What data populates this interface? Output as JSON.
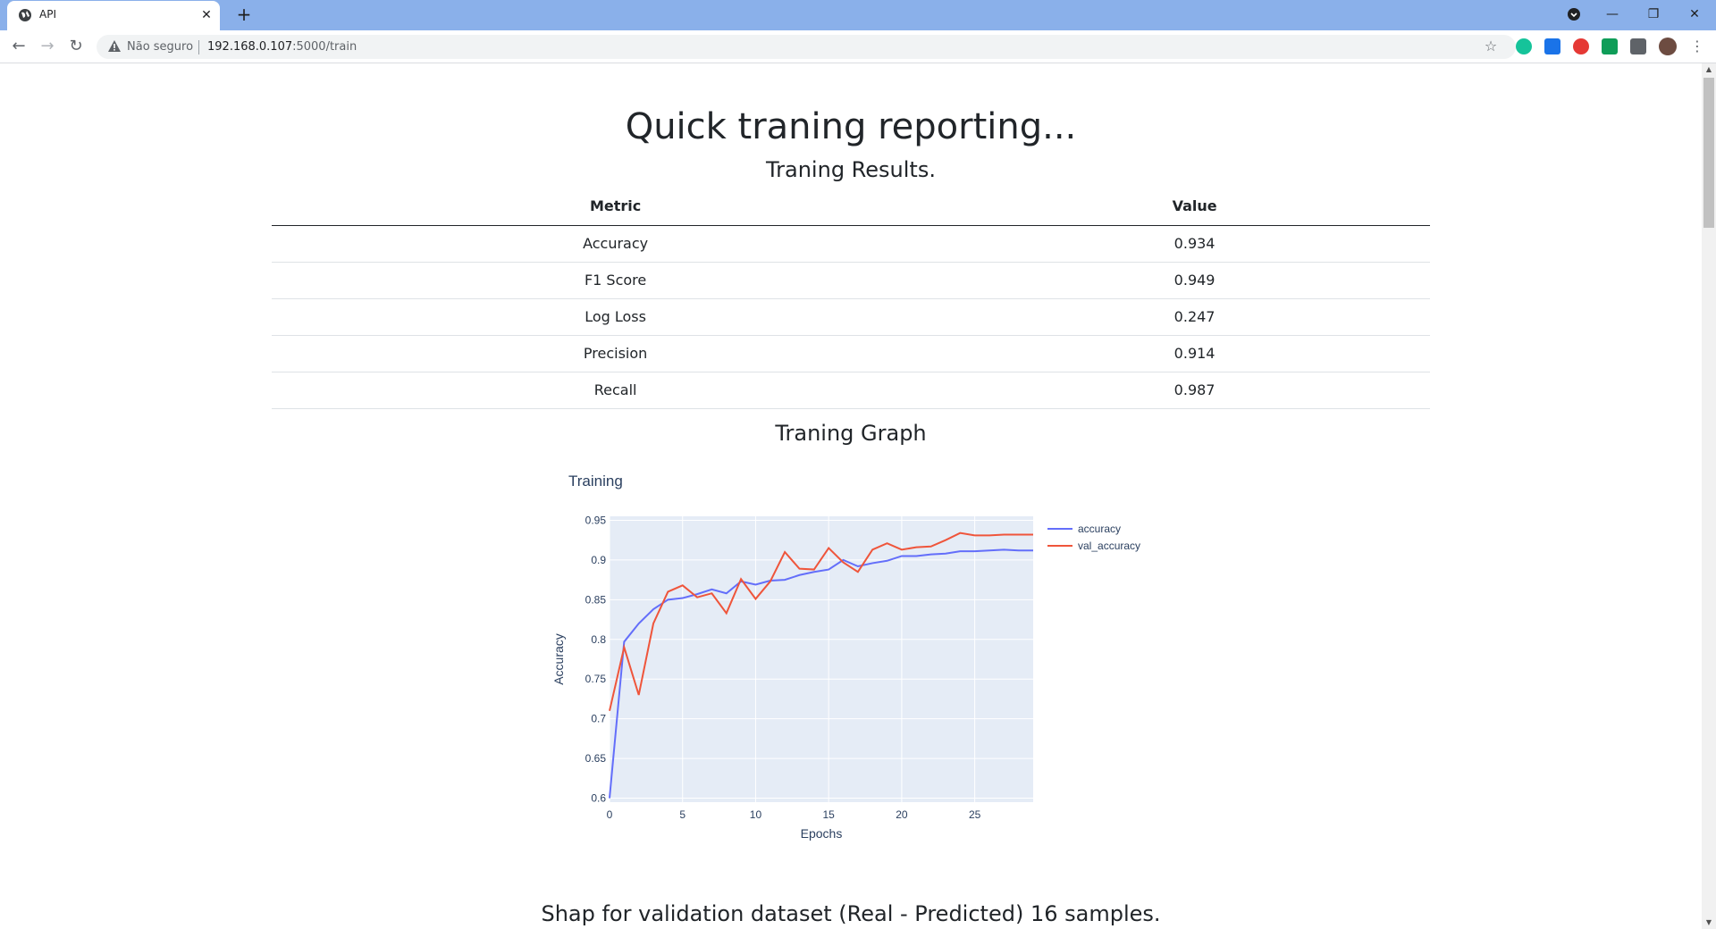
{
  "browser": {
    "tab_title": "API",
    "not_secure_label": "Não seguro",
    "url_host": "192.168.0.107",
    "url_path": ":5000/train"
  },
  "page": {
    "title": "Quick traning reporting...",
    "results_heading": "Traning Results.",
    "graph_heading": "Traning Graph",
    "shap_heading": "Shap for validation dataset (Real - Predicted) 16 samples."
  },
  "metrics_table": {
    "headers": [
      "Metric",
      "Value"
    ],
    "rows": [
      [
        "Accuracy",
        "0.934"
      ],
      [
        "F1 Score",
        "0.949"
      ],
      [
        "Log Loss",
        "0.247"
      ],
      [
        "Precision",
        "0.914"
      ],
      [
        "Recall",
        "0.987"
      ]
    ]
  },
  "colors": {
    "accuracy": "#636efa",
    "val_accuracy": "#ef553b",
    "plot_bg": "#e5ecf6",
    "tabbar": "#8ab0ea"
  },
  "chart_data": {
    "type": "line",
    "title": "Training",
    "xlabel": "Epochs",
    "ylabel": "Accuracy",
    "xlim": [
      0,
      29
    ],
    "ylim": [
      0.595,
      0.955
    ],
    "xticks": [
      0,
      5,
      10,
      15,
      20,
      25
    ],
    "yticks": [
      0.6,
      0.65,
      0.7,
      0.75,
      0.8,
      0.85,
      0.9,
      0.95
    ],
    "ytick_labels": [
      "0.6",
      "0.65",
      "0.7",
      "0.75",
      "0.8",
      "0.85",
      "0.9",
      "0.95"
    ],
    "grid": true,
    "legend": "right",
    "x": [
      0,
      1,
      2,
      3,
      4,
      5,
      6,
      7,
      8,
      9,
      10,
      11,
      12,
      13,
      14,
      15,
      16,
      17,
      18,
      19,
      20,
      21,
      22,
      23,
      24,
      25,
      26,
      27,
      28,
      29
    ],
    "series": [
      {
        "name": "accuracy",
        "values": [
          0.6,
          0.797,
          0.82,
          0.838,
          0.85,
          0.852,
          0.857,
          0.863,
          0.858,
          0.873,
          0.869,
          0.874,
          0.875,
          0.881,
          0.885,
          0.888,
          0.9,
          0.892,
          0.896,
          0.899,
          0.905,
          0.905,
          0.907,
          0.908,
          0.911,
          0.911,
          0.912,
          0.913,
          0.912,
          0.912
        ]
      },
      {
        "name": "val_accuracy",
        "values": [
          0.71,
          0.79,
          0.73,
          0.82,
          0.86,
          0.868,
          0.853,
          0.858,
          0.833,
          0.876,
          0.851,
          0.873,
          0.91,
          0.889,
          0.888,
          0.915,
          0.897,
          0.885,
          0.913,
          0.921,
          0.913,
          0.916,
          0.917,
          0.925,
          0.934,
          0.931,
          0.931,
          0.932,
          0.932,
          0.932
        ]
      }
    ]
  }
}
